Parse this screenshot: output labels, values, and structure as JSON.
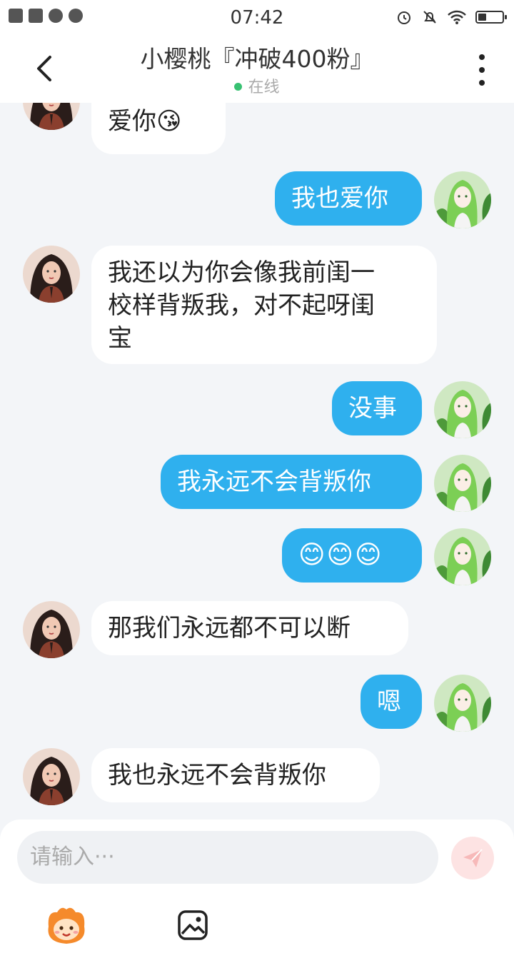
{
  "status_bar": {
    "time": "07:42"
  },
  "header": {
    "title": "小樱桃『冲破400粉』",
    "presence": "在线"
  },
  "messages": [
    {
      "side": "in",
      "lines": [
        "爱你😘"
      ]
    },
    {
      "side": "out",
      "lines": [
        "我也爱你"
      ]
    },
    {
      "side": "in",
      "lines": [
        "我还以为你会像我前闺一",
        "校样背叛我，对不起呀闺",
        "宝"
      ]
    },
    {
      "side": "out",
      "lines": [
        "没事"
      ]
    },
    {
      "side": "out",
      "lines": [
        "我永远不会背叛你"
      ]
    },
    {
      "side": "out",
      "lines": [
        "😊😊😊"
      ]
    },
    {
      "side": "in",
      "lines": [
        "那我们永远都不可以断"
      ]
    },
    {
      "side": "out",
      "lines": [
        "嗯"
      ]
    },
    {
      "side": "in",
      "lines": [
        "我也永远不会背叛你"
      ]
    }
  ],
  "composer": {
    "placeholder": "请输入···"
  },
  "icons": {
    "back": "chevron-left-icon",
    "more": "more-vertical-icon",
    "send": "send-icon",
    "emoji": "emoji-mascot-icon",
    "image": "image-icon"
  },
  "colors": {
    "outgoing_bubble": "#2fb0ee",
    "incoming_bubble": "#ffffff",
    "online_dot": "#38c172",
    "send_button_bg": "#fde3e3"
  }
}
